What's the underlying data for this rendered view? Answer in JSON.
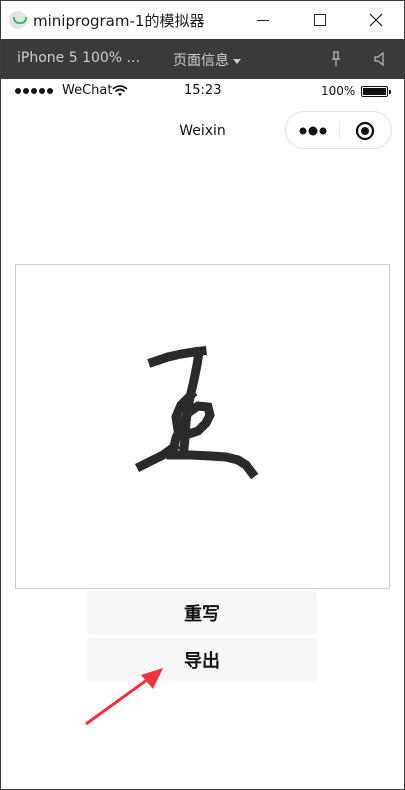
{
  "window": {
    "title": "miniprogram-1的模拟器"
  },
  "toolbar": {
    "device_label": "iPhone 5 100% ...",
    "page_info_label": "页面信息"
  },
  "status_bar": {
    "carrier": "WeChat",
    "time": "15:23",
    "battery": "100%"
  },
  "nav": {
    "title": "Weixin"
  },
  "canvas": {
    "description_icon": "handwritten-stroke"
  },
  "buttons": {
    "rewrite": "重写",
    "export": "导出"
  },
  "colors": {
    "toolbar_bg": "#3a3a3a",
    "button_bg": "#f7f7f7",
    "annotation_arrow": "#e8383d",
    "ink": "#2a2a2a"
  }
}
